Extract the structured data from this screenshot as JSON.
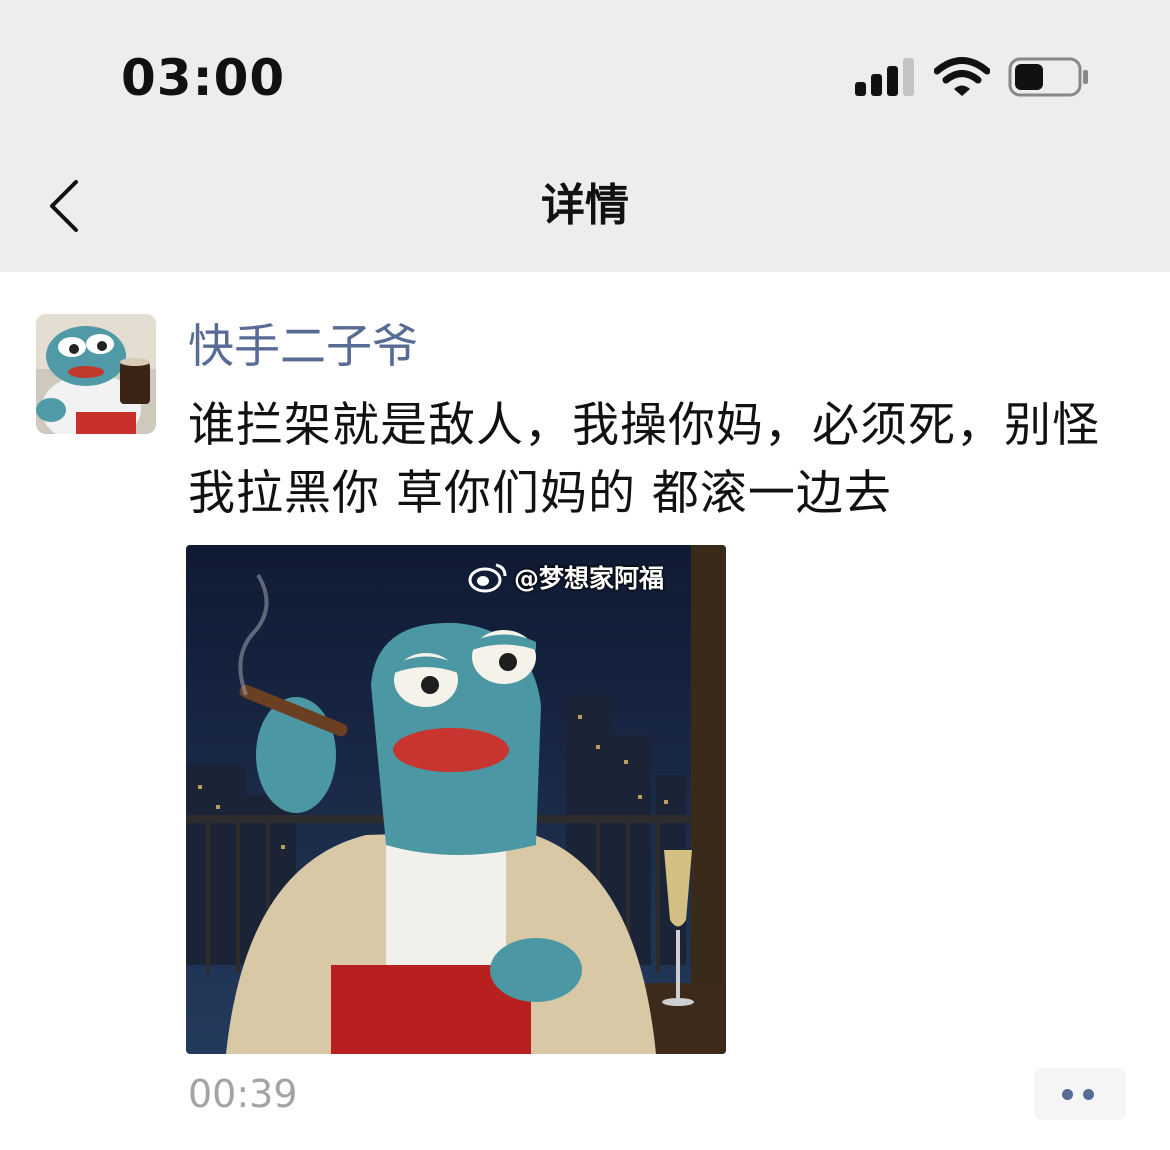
{
  "status_bar": {
    "time": "03:00",
    "signal_icon": "signal-icon",
    "wifi_icon": "wifi-icon",
    "battery_icon": "battery-icon"
  },
  "nav": {
    "back_icon": "chevron-left-icon",
    "title": "详情"
  },
  "post": {
    "username": "快手二子爷",
    "text": "谁拦架就是敌人，我操你妈，必须死，别怪我拉黑你 草你们妈的 都滚一边去",
    "image_watermark": "@梦想家阿福",
    "timestamp": "00:39",
    "more_icon": "more-dots-icon"
  },
  "colors": {
    "link": "#576b95",
    "header_bg": "#ededed",
    "timestamp": "#a3a3a3"
  }
}
